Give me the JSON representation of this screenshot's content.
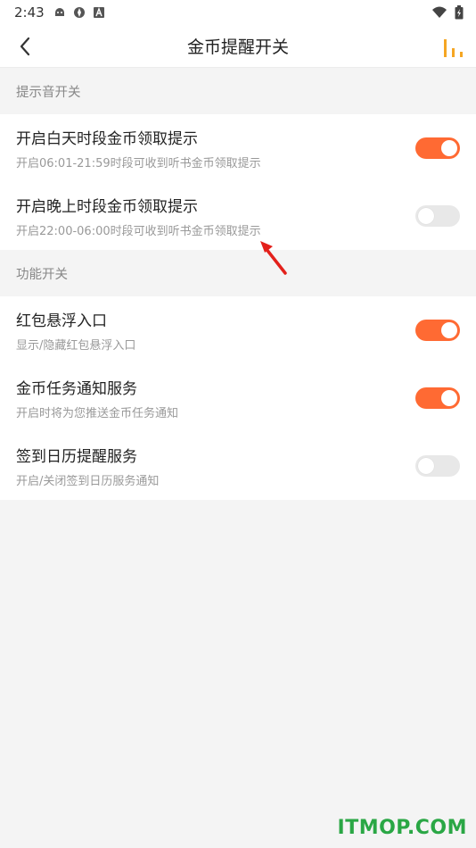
{
  "status_bar": {
    "time": "2:43",
    "icons": [
      "android-debug-icon",
      "gear-app-icon",
      "a-letter-icon"
    ],
    "right_icons": [
      "wifi-icon",
      "battery-icon"
    ]
  },
  "header": {
    "title": "金币提醒开关",
    "back_icon": "chevron-left-icon",
    "right_icon": "bar-chart-icon",
    "accent_color": "#f5a623"
  },
  "sections": [
    {
      "header": "提示音开关",
      "items": [
        {
          "title": "开启白天时段金币领取提示",
          "subtitle": "开启06:01-21:59时段可收到听书金币领取提示",
          "enabled": true
        },
        {
          "title": "开启晚上时段金币领取提示",
          "subtitle": "开启22:00-06:00时段可收到听书金币领取提示",
          "enabled": false
        }
      ]
    },
    {
      "header": "功能开关",
      "items": [
        {
          "title": "红包悬浮入口",
          "subtitle": "显示/隐藏红包悬浮入口",
          "enabled": true
        },
        {
          "title": "金币任务通知服务",
          "subtitle": "开启时将为您推送金币任务通知",
          "enabled": true
        },
        {
          "title": "签到日历提醒服务",
          "subtitle": "开启/关闭签到日历服务通知",
          "enabled": false
        }
      ]
    }
  ],
  "toggle_on_color": "#ff6a33",
  "toggle_off_color": "#e8e8e8",
  "watermark": "ITMOP.COM"
}
